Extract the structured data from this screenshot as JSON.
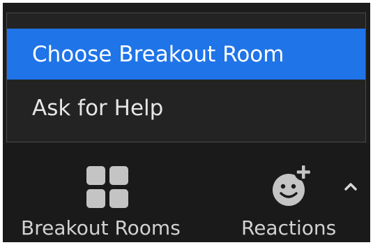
{
  "menu": {
    "items": [
      {
        "label": "Choose Breakout Room",
        "selected": true
      },
      {
        "label": "Ask for Help",
        "selected": false
      }
    ]
  },
  "toolbar": {
    "breakout": {
      "label": "Breakout Rooms",
      "icon": "grid-icon"
    },
    "reactions": {
      "label": "Reactions",
      "icon": "smiley-plus-icon"
    },
    "more_icon": "chevron-up-icon"
  },
  "colors": {
    "background": "#1c1c1c",
    "menu_background": "#232323",
    "selected_item": "#1f74e8",
    "text": "#e6e6e6",
    "icon": "#c4c4c4"
  }
}
